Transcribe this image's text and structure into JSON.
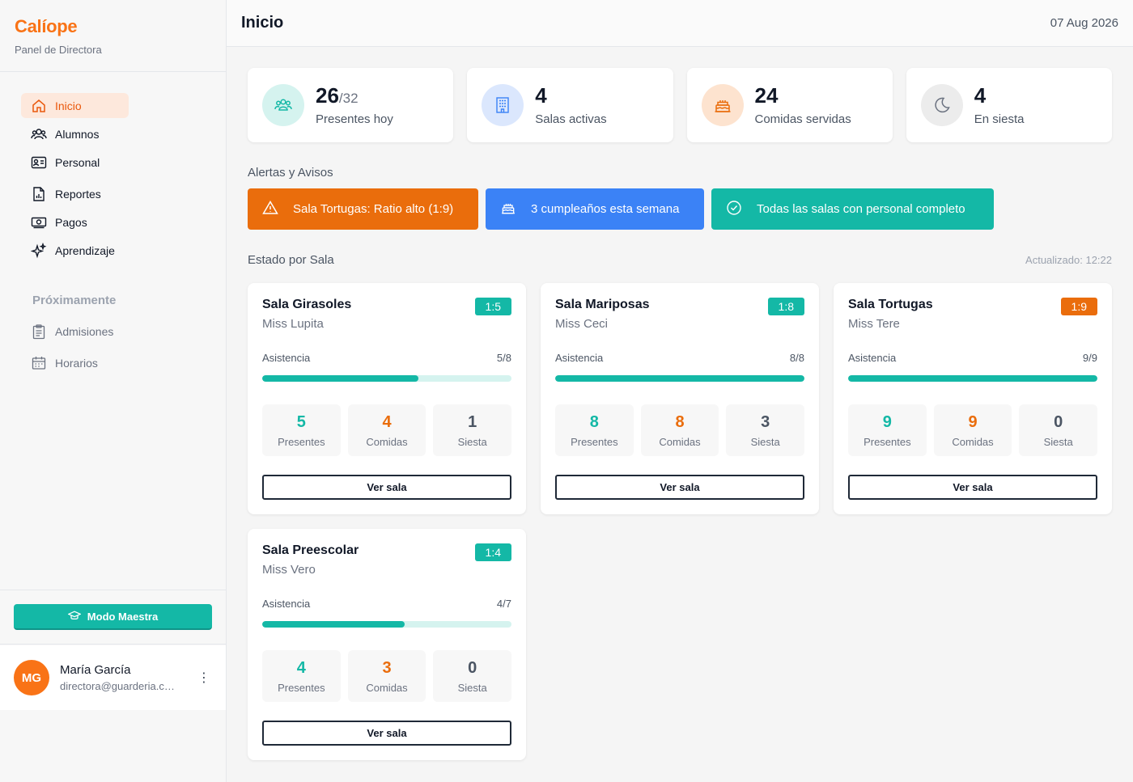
{
  "brand": {
    "name": "Calíope",
    "subtitle": "Panel de Directora"
  },
  "nav": {
    "items": [
      {
        "label": "Inicio",
        "icon": "home-icon",
        "active": true
      },
      {
        "label": "Alumnos",
        "icon": "users-icon"
      },
      {
        "label": "Personal",
        "icon": "id-card-icon"
      },
      {
        "label": "Reportes",
        "icon": "report-file-icon"
      },
      {
        "label": "Pagos",
        "icon": "money-icon"
      },
      {
        "label": "Aprendizaje",
        "icon": "sparkles-icon"
      }
    ],
    "soon_title": "Próximamente",
    "soon_items": [
      {
        "label": "Admisiones",
        "icon": "clipboard-icon"
      },
      {
        "label": "Horarios",
        "icon": "calendar-icon"
      }
    ]
  },
  "teacher_mode": {
    "label": "Modo Maestra"
  },
  "user": {
    "initials": "MG",
    "name": "María García",
    "email": "directora@guarderia.com"
  },
  "header": {
    "title": "Inicio",
    "date": "07 Aug 2026"
  },
  "stats": [
    {
      "value": "26",
      "suffix": "/32",
      "label": "Presentes hoy",
      "icon": "people-group-icon",
      "color": "#d5f3ef"
    },
    {
      "value": "4",
      "suffix": "",
      "label": "Salas activas",
      "icon": "building-icon",
      "color": "#dbe7fd"
    },
    {
      "value": "24",
      "suffix": "",
      "label": "Comidas servidas",
      "icon": "cake-icon",
      "color": "#fde3cf"
    },
    {
      "value": "4",
      "suffix": "",
      "label": "En siesta",
      "icon": "moon-icon",
      "color": "#ececec"
    }
  ],
  "alerts_title": "Alertas y Avisos",
  "alerts": [
    {
      "text": "Sala Tortugas: Ratio alto (1:9)",
      "icon": "warning-icon",
      "color": "#ea6d0c"
    },
    {
      "text": "3 cumpleaños esta semana",
      "icon": "cake-icon",
      "color": "#3b82f6"
    },
    {
      "text": "Todas las salas con personal completo",
      "icon": "check-circle-icon",
      "color": "#14b8a6"
    }
  ],
  "rooms_title": "Estado por Sala",
  "updated": "Actualizado: 12:22",
  "room_labels": {
    "attendance": "Asistencia",
    "present": "Presentes",
    "meals": "Comidas",
    "nap": "Siesta",
    "view": "Ver sala"
  },
  "rooms": [
    {
      "name": "Sala Girasoles",
      "teacher": "Miss Lupita",
      "ratio": "1:5",
      "ratio_status": "ok",
      "attendance": "5/8",
      "attendance_fraction": 0.625,
      "present": "5",
      "meals": "4",
      "nap": "1"
    },
    {
      "name": "Sala Mariposas",
      "teacher": "Miss Ceci",
      "ratio": "1:8",
      "ratio_status": "ok",
      "attendance": "8/8",
      "attendance_fraction": 1.0,
      "present": "8",
      "meals": "8",
      "nap": "3"
    },
    {
      "name": "Sala Tortugas",
      "teacher": "Miss Tere",
      "ratio": "1:9",
      "ratio_status": "warn",
      "attendance": "9/9",
      "attendance_fraction": 1.0,
      "present": "9",
      "meals": "9",
      "nap": "0"
    },
    {
      "name": "Sala Preescolar",
      "teacher": "Miss Vero",
      "ratio": "1:4",
      "ratio_status": "ok",
      "attendance": "4/7",
      "attendance_fraction": 0.571,
      "present": "4",
      "meals": "3",
      "nap": "0"
    }
  ]
}
